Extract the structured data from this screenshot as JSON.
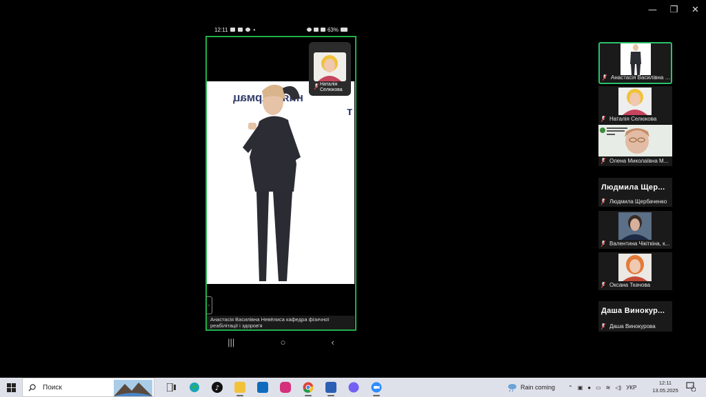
{
  "window": {
    "minimize_icon": "minimize-icon",
    "restore_icon": "restore-icon",
    "close_icon": "close-icon",
    "minimize_glyph": "—",
    "restore_glyph": "❐",
    "close_glyph": "✕"
  },
  "phone": {
    "status_time": "12:11",
    "battery": "63%",
    "pip_name": "Наталія Селюкова",
    "mirror_text": "ння фармац",
    "mirror_text2": "т",
    "caption": "Анастасія Василівна Невёлиса кафедра фізичної реабілітації і здоров'я",
    "nav_recent": "|||",
    "nav_home": "○",
    "nav_back": "‹"
  },
  "participants": [
    {
      "name": "Анастасія Василівна Невё..."
    },
    {
      "name": "Наталія Селюкова"
    },
    {
      "name": "Олена Миколаївна М..."
    },
    {
      "name": "Людмила Щербаченко",
      "big_name": "Людмила  Щер..."
    },
    {
      "name": "Валентина Чікіткіна, к..."
    },
    {
      "name": "Оксана Ткачова"
    },
    {
      "name": "Даша Винокурова",
      "big_name": "Даша  Винокур..."
    }
  ],
  "taskbar": {
    "search_label": "Поиск",
    "weather": "Rain coming",
    "language": "УКР",
    "time": "12:11",
    "date": "13.05.2025",
    "notifications": "2"
  },
  "colors": {
    "active_border": "#22b04a",
    "taskbar_bg": "#dfe1ea"
  }
}
